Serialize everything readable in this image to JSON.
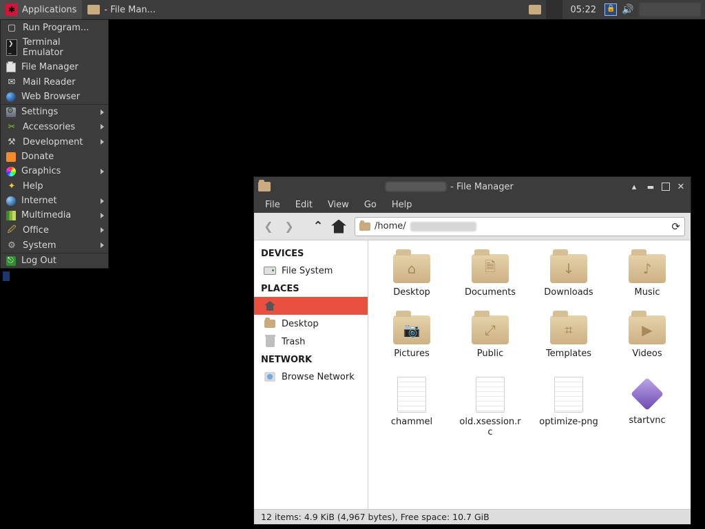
{
  "panel": {
    "applications_label": "Applications",
    "taskbar_item": "             - File Man...",
    "clock": "05:22"
  },
  "apps_menu": {
    "items": [
      {
        "label": "Run Program...",
        "icon": "run",
        "submenu": false
      },
      {
        "label": "Terminal Emulator",
        "icon": "term",
        "submenu": false
      },
      {
        "label": "File Manager",
        "icon": "fm",
        "submenu": false
      },
      {
        "label": "Mail Reader",
        "icon": "mail",
        "submenu": false
      },
      {
        "label": "Web Browser",
        "icon": "web",
        "submenu": false
      }
    ],
    "cat_items": [
      {
        "label": "Settings",
        "icon": "settings",
        "submenu": true
      },
      {
        "label": "Accessories",
        "icon": "acc",
        "submenu": true
      },
      {
        "label": "Development",
        "icon": "dev",
        "submenu": true
      },
      {
        "label": "Donate",
        "icon": "donate",
        "submenu": false
      },
      {
        "label": "Graphics",
        "icon": "gfx",
        "submenu": true
      },
      {
        "label": "Help",
        "icon": "help",
        "submenu": false
      },
      {
        "label": "Internet",
        "icon": "net",
        "submenu": true
      },
      {
        "label": "Multimedia",
        "icon": "mm",
        "submenu": true
      },
      {
        "label": "Office",
        "icon": "office",
        "submenu": true
      },
      {
        "label": "System",
        "icon": "system",
        "submenu": true
      }
    ],
    "logout_label": "Log Out"
  },
  "window": {
    "title_suffix": " - File Manager",
    "menubar": [
      "File",
      "Edit",
      "View",
      "Go",
      "Help"
    ],
    "path_prefix": "/home/",
    "sidebar": {
      "devices_header": "DEVICES",
      "devices": [
        {
          "label": "File System"
        }
      ],
      "places_header": "PLACES",
      "places": [
        {
          "label": "",
          "active": true,
          "icon": "home"
        },
        {
          "label": "Desktop",
          "active": false,
          "icon": "desktop"
        },
        {
          "label": "Trash",
          "active": false,
          "icon": "trash"
        }
      ],
      "network_header": "NETWORK",
      "network": [
        {
          "label": "Browse Network"
        }
      ]
    },
    "files": [
      {
        "name": "Desktop",
        "type": "folder",
        "glyph": "⌂"
      },
      {
        "name": "Documents",
        "type": "folder",
        "glyph": "🗎"
      },
      {
        "name": "Downloads",
        "type": "folder",
        "glyph": "↓"
      },
      {
        "name": "Music",
        "type": "folder",
        "glyph": "♪"
      },
      {
        "name": "Pictures",
        "type": "folder",
        "glyph": "📷"
      },
      {
        "name": "Public",
        "type": "folder",
        "glyph": "⤢"
      },
      {
        "name": "Templates",
        "type": "folder",
        "glyph": "⌗"
      },
      {
        "name": "Videos",
        "type": "folder",
        "glyph": "▶"
      },
      {
        "name": "chammel",
        "type": "text"
      },
      {
        "name": "old.xsession.rc",
        "type": "text"
      },
      {
        "name": "optimize-png",
        "type": "text"
      },
      {
        "name": "startvnc",
        "type": "binary"
      }
    ],
    "status": "12 items: 4.9 KiB (4,967 bytes), Free space: 10.7 GiB"
  }
}
